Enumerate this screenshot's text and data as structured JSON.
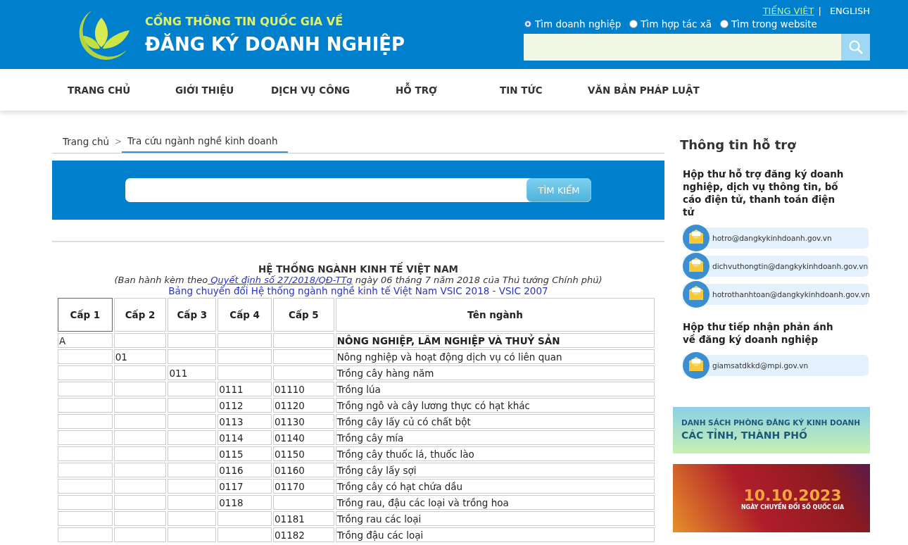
{
  "header": {
    "subtitle": "CỔNG THÔNG TIN QUỐC GIA VỀ",
    "title": "ĐĂNG KÝ DOANH NGHIỆP",
    "languages": [
      {
        "label": "TIẾNG VIỆT",
        "selected": true
      },
      {
        "label": "ENGLISH",
        "selected": false
      }
    ],
    "separator": "|",
    "search_modes": [
      {
        "label": "Tìm doanh nghiệp",
        "selected": true
      },
      {
        "label": "Tìm hợp tác xã",
        "selected": false
      },
      {
        "label": "Tìm trong website",
        "selected": false
      }
    ]
  },
  "nav": [
    "TRANG CHỦ",
    "GIỚI THIỆU",
    "DỊCH VỤ CÔNG",
    "HỖ TRỢ",
    "TIN TỨC",
    "VĂN BẢN PHÁP LUẬT"
  ],
  "breadcrumb": {
    "items": [
      "Trang chủ",
      "Tra cứu ngành nghề kinh doanh"
    ],
    "separator": ">"
  },
  "lookup": {
    "button": "TÌM KIẾM"
  },
  "document": {
    "title": "HỆ THỐNG NGÀNH KINH TẾ VIỆT NAM",
    "note_before": "(Ban hành kèm theo",
    "note_link": " Quyết định số 27/2018/QĐ-TTg",
    "note_after": " ngày 06 tháng 7 năm 2018 của Thủ tướng Chính phủ)",
    "conversion_link": "Bảng chuyển đổi Hệ thống ngành nghề kinh tế Việt Nam VSIC 2018 - VSIC 2007"
  },
  "table": {
    "columns": [
      "Cấp 1",
      "Cấp 2",
      "Cấp 3",
      "Cấp 4",
      "Cấp 5",
      "Tên ngành"
    ],
    "rows": [
      {
        "cells": [
          "A",
          "",
          "",
          "",
          "",
          "NÔNG NGHIỆP, LÂM NGHIỆP VÀ THUỶ SẢN"
        ],
        "bold": true
      },
      {
        "cells": [
          "",
          "01",
          "",
          "",
          "",
          "Nông nghiệp và hoạt động dịch vụ có liên quan"
        ],
        "bold": false
      },
      {
        "cells": [
          "",
          "",
          "011",
          "",
          "",
          "Trồng cây hàng năm"
        ],
        "bold": false
      },
      {
        "cells": [
          "",
          "",
          "",
          "0111",
          "01110",
          "Trồng lúa"
        ],
        "bold": false
      },
      {
        "cells": [
          "",
          "",
          "",
          "0112",
          "01120",
          "Trồng ngô và cây lương thực có hạt khác"
        ],
        "bold": false
      },
      {
        "cells": [
          "",
          "",
          "",
          "0113",
          "01130",
          "Trồng cây lấy củ có chất bột"
        ],
        "bold": false
      },
      {
        "cells": [
          "",
          "",
          "",
          "0114",
          "01140",
          "Trồng cây mía"
        ],
        "bold": false
      },
      {
        "cells": [
          "",
          "",
          "",
          "0115",
          "01150",
          "Trồng cây thuốc lá, thuốc lào"
        ],
        "bold": false
      },
      {
        "cells": [
          "",
          "",
          "",
          "0116",
          "01160",
          "Trồng cây lấy sợi"
        ],
        "bold": false
      },
      {
        "cells": [
          "",
          "",
          "",
          "0117",
          "01170",
          "Trồng cây có hạt chứa dầu"
        ],
        "bold": false
      },
      {
        "cells": [
          "",
          "",
          "",
          "0118",
          "",
          "Trồng rau, đậu các loại và trồng hoa"
        ],
        "bold": false
      },
      {
        "cells": [
          "",
          "",
          "",
          "",
          "01181",
          "Trồng rau các loại"
        ],
        "bold": false
      },
      {
        "cells": [
          "",
          "",
          "",
          "",
          "01182",
          "Trồng đậu các loại"
        ],
        "bold": false
      }
    ]
  },
  "sidebar": {
    "title": "Thông tin hỗ trợ",
    "groups": [
      {
        "heading": "Hộp thư hỗ trợ đăng ký doanh nghiệp, dịch vụ thông tin, bố cáo điện tử, thanh toán điện tử",
        "emails": [
          "hotro@dangkykinhdoanh.gov.vn",
          "dichvuthongtin@dangkykinhdoanh.gov.vn",
          "hotrothanhtoan@dangkykinhdoanh.gov.vn"
        ]
      },
      {
        "heading": "Hộp thư tiếp nhận phản ánh về đăng ký doanh nghiệp",
        "emails": [
          "giamsatdkkd@mpi.gov.vn"
        ]
      }
    ],
    "banners": [
      {
        "kind": "city",
        "lines": [
          "DANH SÁCH PHÒNG ĐĂNG KÝ KINH DOANH",
          "CÁC TỈNH, THÀNH PHỐ"
        ]
      },
      {
        "kind": "event",
        "lines": [
          "10.10.2023",
          "NGÀY CHUYỂN ĐỔI SỐ QUỐC GIA"
        ]
      }
    ]
  }
}
